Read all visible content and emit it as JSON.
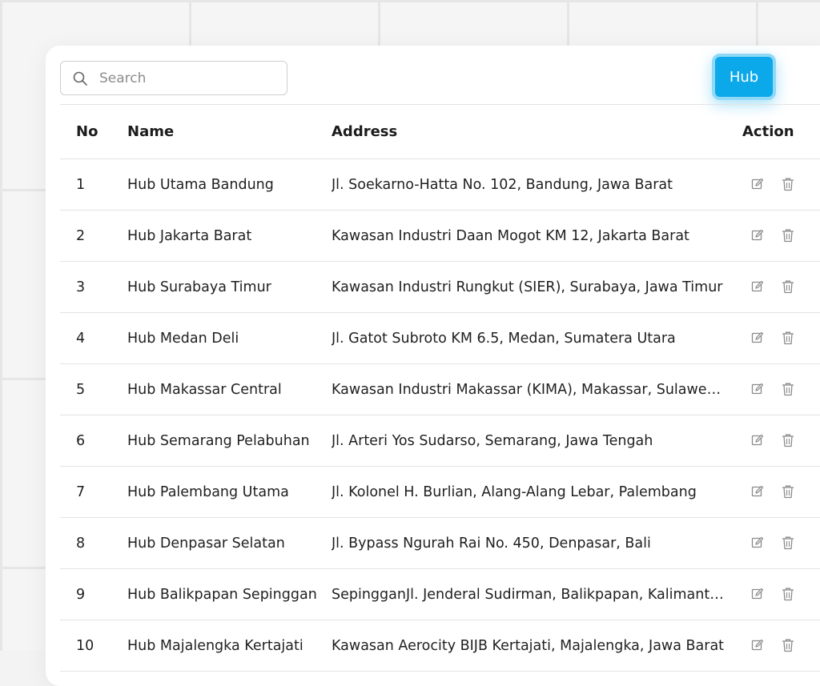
{
  "search": {
    "placeholder": "Search",
    "value": ""
  },
  "hub_button": {
    "label": "Hub"
  },
  "table": {
    "headers": {
      "no": "No",
      "name": "Name",
      "address": "Address",
      "action": "Action"
    },
    "rows": [
      {
        "no": "1",
        "name": "Hub Utama Bandung",
        "address": "Jl. Soekarno-Hatta No. 102, Bandung, Jawa Barat"
      },
      {
        "no": "2",
        "name": "Hub Jakarta Barat",
        "address": "Kawasan Industri Daan Mogot KM 12, Jakarta Barat"
      },
      {
        "no": "3",
        "name": "Hub Surabaya Timur",
        "address": "Kawasan Industri Rungkut (SIER), Surabaya, Jawa Timur"
      },
      {
        "no": "4",
        "name": "Hub Medan Deli",
        "address": "Jl. Gatot Subroto KM 6.5, Medan, Sumatera Utara"
      },
      {
        "no": "5",
        "name": "Hub Makassar Central",
        "address": "Kawasan Industri Makassar (KIMA), Makassar, Sulawesi Se..."
      },
      {
        "no": "6",
        "name": "Hub Semarang Pelabuhan",
        "address": "Jl. Arteri Yos Sudarso, Semarang, Jawa Tengah"
      },
      {
        "no": "7",
        "name": "Hub Palembang Utama",
        "address": "Jl. Kolonel H. Burlian, Alang-Alang Lebar, Palembang"
      },
      {
        "no": "8",
        "name": "Hub Denpasar Selatan",
        "address": "Jl. Bypass Ngurah Rai No. 450, Denpasar, Bali"
      },
      {
        "no": "9",
        "name": "Hub Balikpapan Sepinggan",
        "address": " SepingganJl. Jenderal Sudirman, Balikpapan, Kalimantan..."
      },
      {
        "no": "10",
        "name": "Hub Majalengka Kertajati",
        "address": "Kawasan Aerocity BIJB Kertajati, Majalengka, Jawa Barat"
      }
    ]
  },
  "icons": {
    "search": "search-icon",
    "edit": "edit-icon",
    "delete": "trash-icon"
  },
  "colors": {
    "accent": "#0ba8ea",
    "accent_ring": "#8fd8f6"
  }
}
